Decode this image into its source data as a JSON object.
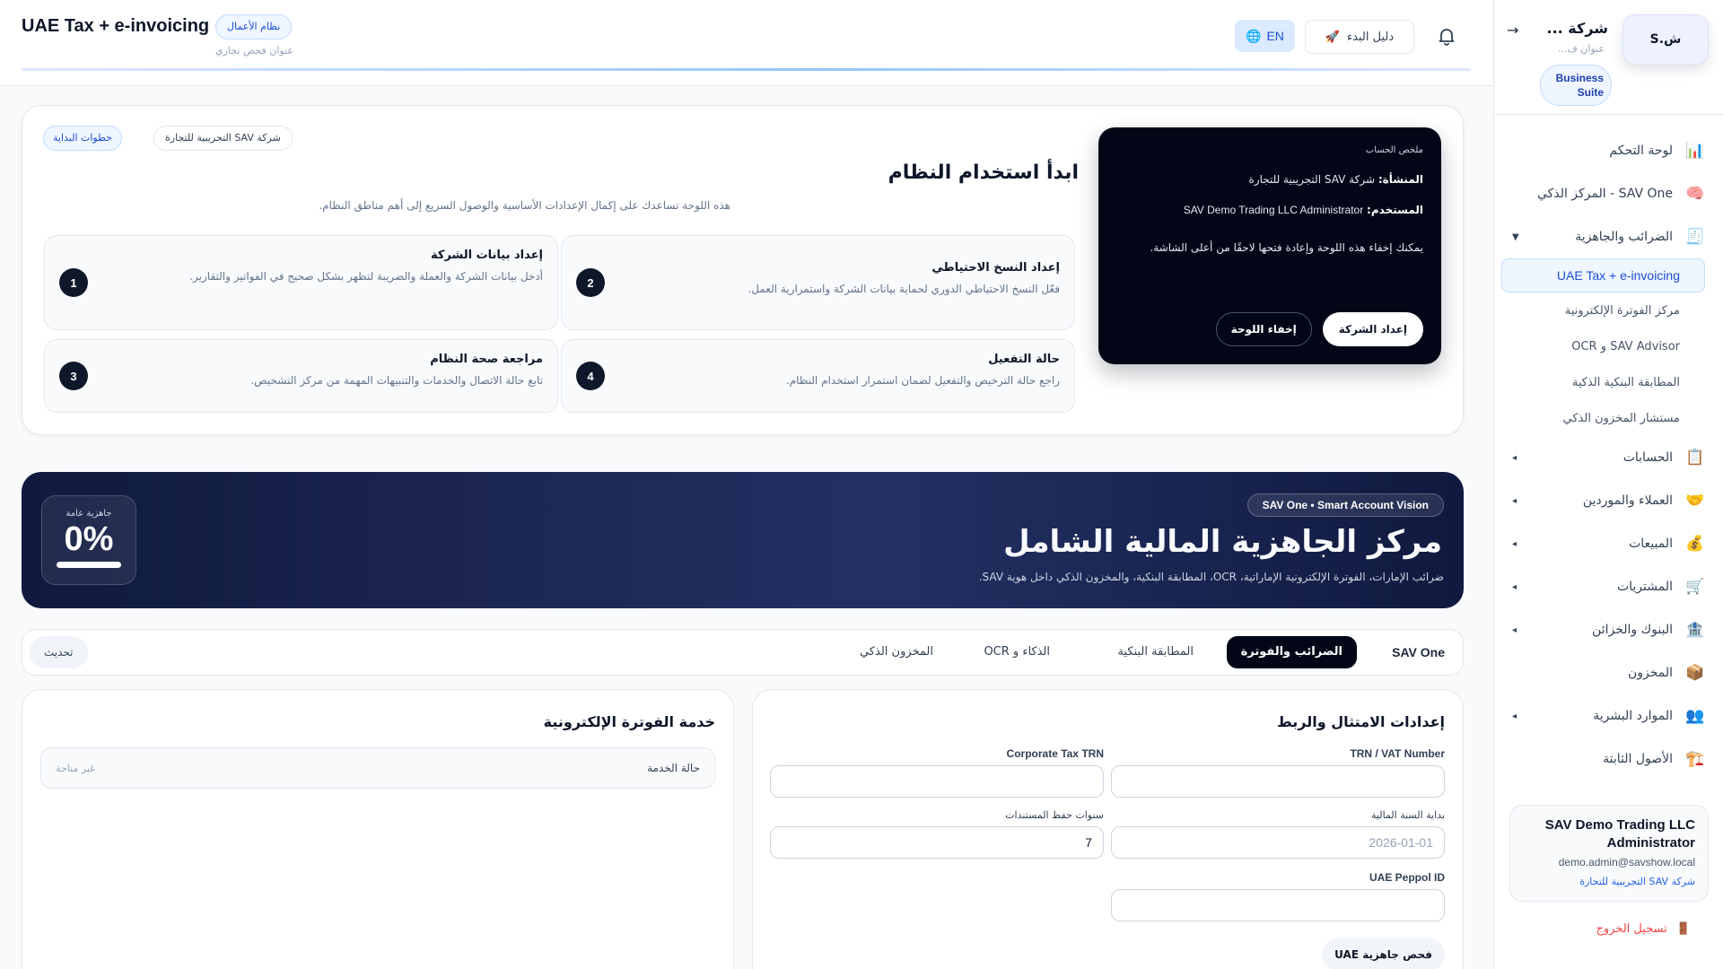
{
  "header": {
    "title": "UAE Tax + e-invoicing",
    "badge": "نظام الأعمال",
    "subtitle": "عنوان فحص تجاري",
    "lang_label": "EN",
    "guide_label": "دليل البدء"
  },
  "sidebar": {
    "logo_text": "ش.S",
    "company": "شركة ...",
    "company_sub": "عنوان ف...",
    "suite_label": "Business Suite",
    "items": [
      {
        "label": "لوحة التحكم",
        "icon": "📊"
      },
      {
        "label": "SAV One - المركز الذكي",
        "icon": "🧠"
      },
      {
        "label": "الضرائب والجاهزية",
        "icon": "🧾",
        "caret": "▼"
      },
      {
        "label": "الحسابات",
        "icon": "📋",
        "caret": "◂"
      },
      {
        "label": "العملاء والموردين",
        "icon": "🤝",
        "caret": "◂"
      },
      {
        "label": "المبيعات",
        "icon": "💰",
        "caret": "◂"
      },
      {
        "label": "المشتريات",
        "icon": "🛒",
        "caret": "◂"
      },
      {
        "label": "البنوك والخزائن",
        "icon": "🏦",
        "caret": "◂"
      },
      {
        "label": "المخزون",
        "icon": "📦"
      },
      {
        "label": "الموارد البشرية",
        "icon": "👥",
        "caret": "◂"
      },
      {
        "label": "الأصول الثابتة",
        "icon": "🏗️"
      }
    ],
    "sub_items": [
      "UAE Tax + e-invoicing",
      "مركز الفوترة الإلكترونية",
      "SAV Advisor و OCR",
      "المطابقة البنكية الذكية",
      "مستشار المخزون الذكي"
    ],
    "user": {
      "name": "SAV Demo Trading LLC Administrator",
      "email": "demo.admin@savshow.local",
      "company": "شركة SAV التجريبية للتجارة"
    },
    "logout_label": "تسجيل الخروج"
  },
  "onboarding": {
    "tag_steps": "خطوات البداية",
    "tag_company": "شركة SAV التجريبية للتجارة",
    "title": "ابدأ استخدام النظام",
    "description": "هذه اللوحة تساعدك على إكمال الإعدادات الأساسية والوصول السريع إلى أهم مناطق النظام.",
    "steps": [
      {
        "num": "1",
        "title": "إعداد بيانات الشركة",
        "desc": "أدخل بيانات الشركة والعملة والضريبة لتظهر بشكل صحيح في الفواتير والتقارير."
      },
      {
        "num": "2",
        "title": "إعداد النسخ الاحتياطي",
        "desc": "فعّل النسخ الاحتياطي الدوري لحماية بيانات الشركة واستمرارية العمل."
      },
      {
        "num": "3",
        "title": "مراجعة صحة النظام",
        "desc": "تابع حالة الاتصال والخدمات والتنبيهات المهمة من مركز التشخيص."
      },
      {
        "num": "4",
        "title": "حالة التفعيل",
        "desc": "راجع حالة الترخيص والتفعيل لضمان استمرار استخدام النظام."
      }
    ],
    "account": {
      "heading": "ملخص الحساب",
      "org_label": "المنشأة:",
      "org_value": "شركة SAV التجريبية للتجارة",
      "user_label": "المستخدم:",
      "user_value": "SAV Demo Trading LLC Administrator",
      "note": "يمكنك إخفاء هذه اللوحة وإعادة فتحها لاحقًا من أعلى الشاشة.",
      "setup_button": "إعداد الشركة",
      "hide_button": "إخفاء اللوحة"
    }
  },
  "hero": {
    "badge": "SAV One • Smart Account Vision",
    "title": "مركز الجاهزية المالية الشامل",
    "subtitle": "ضرائب الإمارات، الفوترة الإلكترونية الإماراتية، OCR، المطابقة البنكية، والمخزون الذكي داخل هوية SAV.",
    "readiness_label": "جاهزية عامة",
    "readiness_value": "0%",
    "readiness_fraction": 0
  },
  "tabs": {
    "items": [
      "SAV One",
      "الضرائب والفوترة",
      "المطابقة البنكية",
      "الذكاء و OCR",
      "المخزون الذكي"
    ],
    "active": "الضرائب والفوترة",
    "refresh_label": "تحديث"
  },
  "compliance": {
    "title": "إعدادات الامتثال والربط",
    "trn_label": "TRN / VAT Number",
    "trn_value": "",
    "ct_label": "Corporate Tax TRN",
    "ct_value": "",
    "fy_label": "بداية السنة المالية",
    "fy_placeholder": "2026-01-01",
    "retention_label": "سنوات حفظ المستندات",
    "retention_value": "7",
    "peppol_label": "UAE Peppol ID",
    "peppol_value": "",
    "check_button": "فحص جاهزية UAE"
  },
  "einvoice": {
    "title": "خدمة الفوترة الإلكترونية",
    "status_label": "حالة الخدمة",
    "status_value": "غير متاحة"
  },
  "colors": {
    "accent": "#1d4ed8",
    "dark": "#020617",
    "hero_bg": "#1b2550",
    "danger": "#ef4444"
  }
}
